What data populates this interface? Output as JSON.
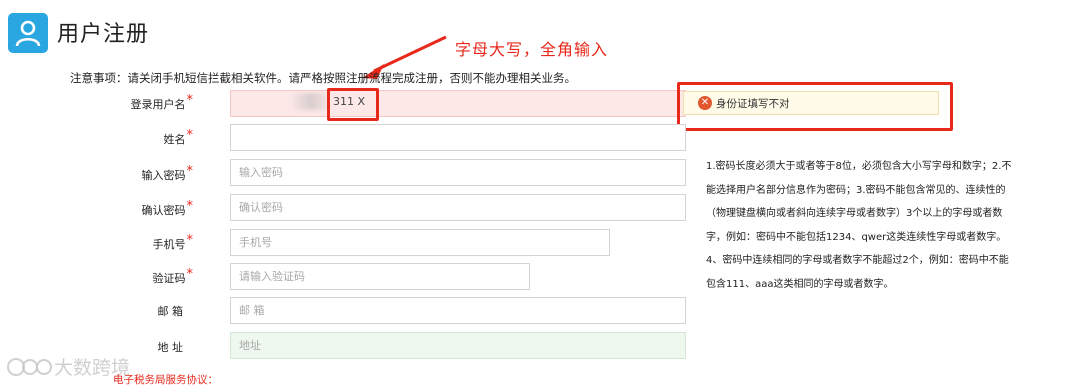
{
  "header": {
    "title": "用户注册"
  },
  "annotation": {
    "text": "字母大写，全角输入"
  },
  "notice": "注意事项：请关闭手机短信拦截相关软件。请严格按照注册流程完成注册，否则不能办理相关业务。",
  "form": {
    "username": {
      "label": "登录用户名",
      "value": "311 X"
    },
    "name": {
      "label": "姓名",
      "value": ""
    },
    "password": {
      "label": "输入密码",
      "placeholder": "输入密码"
    },
    "confirm": {
      "label": "确认密码",
      "placeholder": "确认密码"
    },
    "phone": {
      "label": "手机号",
      "placeholder": "手机号"
    },
    "captcha": {
      "label": "验证码",
      "placeholder": "请输入验证码"
    },
    "email": {
      "label": "邮 箱",
      "placeholder": "邮 箱"
    },
    "address": {
      "label": "地 址",
      "placeholder": "地址"
    }
  },
  "error_tip": {
    "icon": "error-x-icon",
    "text": "身份证填写不对"
  },
  "password_rules": "1.密码长度必须大于或者等于8位，必须包含大小写字母和数字；2.不能选择用户名部分信息作为密码；3.密码不能包含常见的、连续性的（物理键盘横向或者斜向连续字母或者数字）3个以上的字母或者数字，例如：密码中不能包括1234、qwer这类连续性字母或者数字。4、密码中连续相同的字母或者数字不能超过2个，例如：密码中不能包含111、aaa这类相同的字母或者数字。",
  "watermark": "大数跨境",
  "footer": {
    "link": "电子税务局服务协议："
  },
  "colors": {
    "accent": "#2aa6e0",
    "annotation_red": "#e8281b",
    "error_bg": "#fde8e8",
    "tip_bg": "#fffbe8"
  }
}
